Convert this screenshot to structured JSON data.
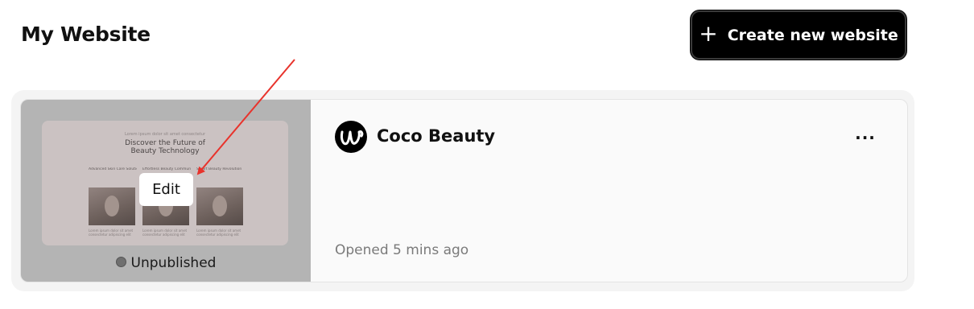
{
  "header": {
    "title": "My Website",
    "create_button": {
      "icon": "plus-icon",
      "label": "Create new website"
    }
  },
  "site_card": {
    "preview": {
      "small_text": "Lorem ipsum dolor sit amet consectetur",
      "headline_line1": "Discover the Future of",
      "headline_line2": "Beauty Technology",
      "columns": [
        {
          "title": "Advanced Skin Care Solutions",
          "caption": "Lorem ipsum dolor sit amet consectetur adipiscing elit"
        },
        {
          "title": "Effortless Beauty Community",
          "caption": "Lorem ipsum dolor sit amet consectetur adipiscing elit"
        },
        {
          "title": "Smart Beauty Revolution",
          "caption": "Lorem ipsum dolor sit amet consectetur adipiscing elit"
        }
      ]
    },
    "edit_label": "Edit",
    "status_label": "Unpublished",
    "logo_icon": "coco-logo-icon",
    "site_name": "Coco Beauty",
    "more_icon": "more-horizontal-icon",
    "more_label": "···",
    "opened_text": "Opened 5 mins ago"
  },
  "colors": {
    "annotation_arrow": "#e8332c",
    "button_bg": "#000000",
    "card_bg": "#fafafa",
    "status_dot": "#6f6f6f"
  }
}
